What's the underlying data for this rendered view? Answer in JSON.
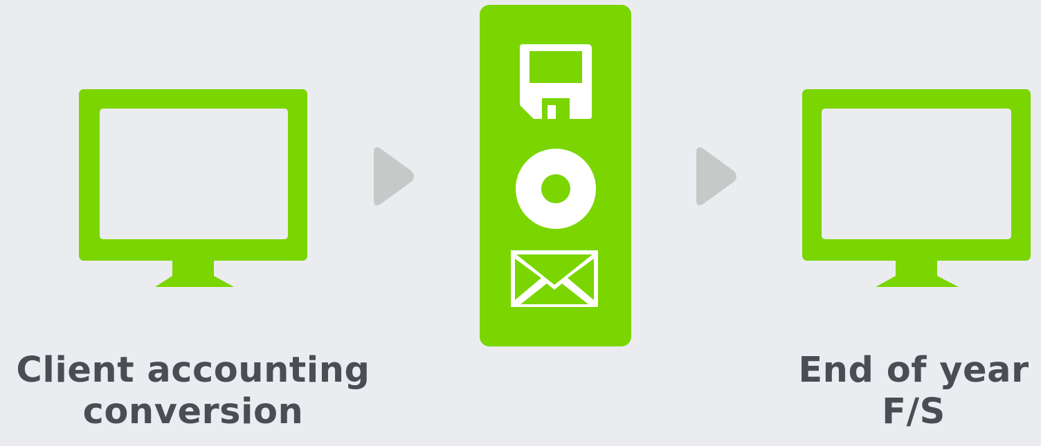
{
  "colors": {
    "background": "#ebecf0",
    "accent": "#7ad500",
    "arrow": "#c5c9c8",
    "text": "#4b4c54"
  },
  "nodes": [
    {
      "icon": "monitor-icon",
      "caption_lines": [
        "Client accounting",
        "conversion"
      ]
    },
    {
      "icon": "media-panel",
      "media_icons": [
        "floppy-disk-icon",
        "disc-icon",
        "envelope-icon"
      ]
    },
    {
      "icon": "monitor-icon",
      "caption_lines": [
        "End of year",
        "F/S"
      ]
    }
  ],
  "arrows": [
    "arrow-right-icon",
    "arrow-right-icon"
  ]
}
